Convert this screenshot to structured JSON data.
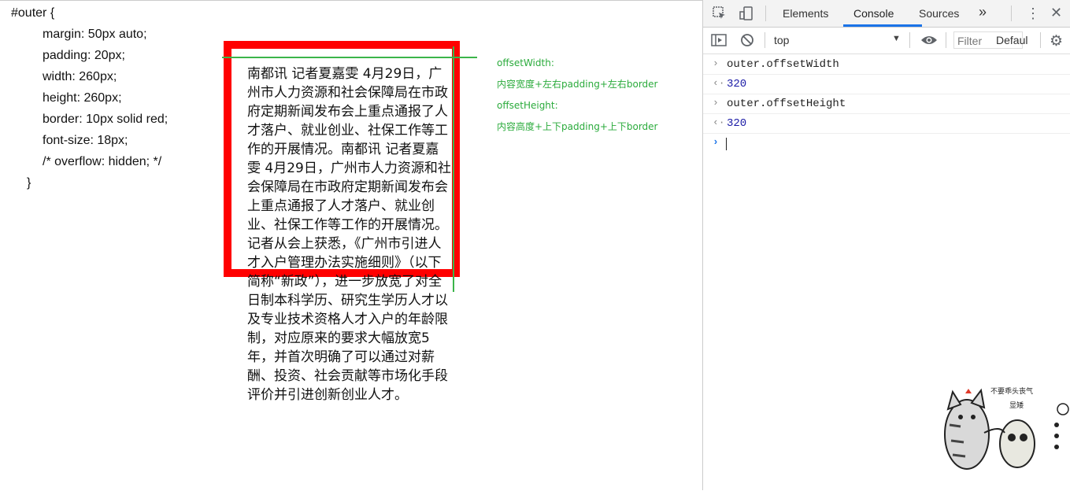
{
  "page": {
    "code_lines": [
      "#outer {",
      "margin: 50px auto;",
      "padding: 20px;",
      "width: 260px;",
      "height: 260px;",
      "border: 10px solid red;",
      "font-size: 18px;",
      "/* overflow: hidden; */",
      "}"
    ],
    "box_text": "南都讯 记者夏嘉雯 4月29日，广州市人力资源和社会保障局在市政府定期新闻发布会上重点通报了人才落户、就业创业、社保工作等工作的开展情况。南都讯 记者夏嘉雯 4月29日，广州市人力资源和社会保障局在市政府定期新闻发布会上重点通报了人才落户、就业创业、社保工作等工作的开展情况。记者从会上获悉，《广州市引进人才入户管理办法实施细则》（以下简称“新政”），进一步放宽了对全日制本科学历、研究生学历人才以及专业技术资格人才入户的年龄限制，对应原来的要求大幅放宽5年，并首次明确了可以通过对薪酬、投资、社会贡献等市场化手段评价并引进创新创业人才。",
    "annotations": {
      "width_label": "offsetWidth:",
      "width_formula": "内容宽度+左右padding+左右border",
      "height_label": "offsetHeight:",
      "height_formula": "内容高度+上下padding+上下border"
    },
    "sticker_text": "不要乖头丧气 显矮"
  },
  "devtools": {
    "tabs": [
      "Elements",
      "Console",
      "Sources"
    ],
    "active_tab": "Console",
    "more_tabs": "»",
    "context": "top",
    "filter_placeholder": "Filter",
    "levels": "Defaul",
    "console": [
      {
        "type": "input",
        "text": "outer.offsetWidth"
      },
      {
        "type": "output",
        "text": "320"
      },
      {
        "type": "input",
        "text": "outer.offsetHeight"
      },
      {
        "type": "output",
        "text": "320"
      }
    ],
    "colors": {
      "accent": "#1a73e8",
      "number": "#1a1aa6",
      "annotation": "#2bab3c",
      "border": "#ff0000"
    }
  }
}
